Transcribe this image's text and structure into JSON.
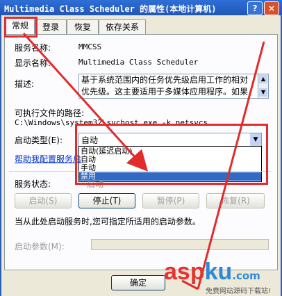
{
  "window": {
    "title": "Multimedia Class Scheduler 的属性(本地计算机)",
    "help": "?",
    "close": "×"
  },
  "tabs": [
    "常规",
    "登录",
    "恢复",
    "依存关系"
  ],
  "general": {
    "service_name_label": "服务名称:",
    "service_name": "MMCSS",
    "display_name_label": "显示名称:",
    "display_name": "Multimedia Class Scheduler",
    "description_label": "描述:",
    "description_line1": "基于系统范围内的任务优先级启用工作的相对",
    "description_line2": "优先级。这主要适用于多媒体应用程序。如果",
    "path_label": "可执行文件的路径:",
    "path": "C:\\Windows\\system32\\svchost.exe -k netsvcs",
    "startup_type_label": "启动类型(E):",
    "startup_type_value": "自动",
    "startup_options": [
      "自动(延迟启动)",
      "自动",
      "手动",
      "禁用"
    ],
    "help_link": "帮助我配置服务启",
    "status_label": "服务状态:",
    "status_value": "启动",
    "btn_start": "启动(S)",
    "btn_stop": "停止(T)",
    "btn_pause": "暂停(P)",
    "btn_resume": "恢复(R)",
    "hint": "当从此处启动服务时,您可指定所适用的启动参数。",
    "params_label": "启动参数(M):"
  },
  "footer": {
    "ok": "确定"
  },
  "watermark": {
    "brand": "asp",
    "brand2": "ku",
    "suffix": ".com",
    "tagline": "免费网站源码下载站!"
  }
}
